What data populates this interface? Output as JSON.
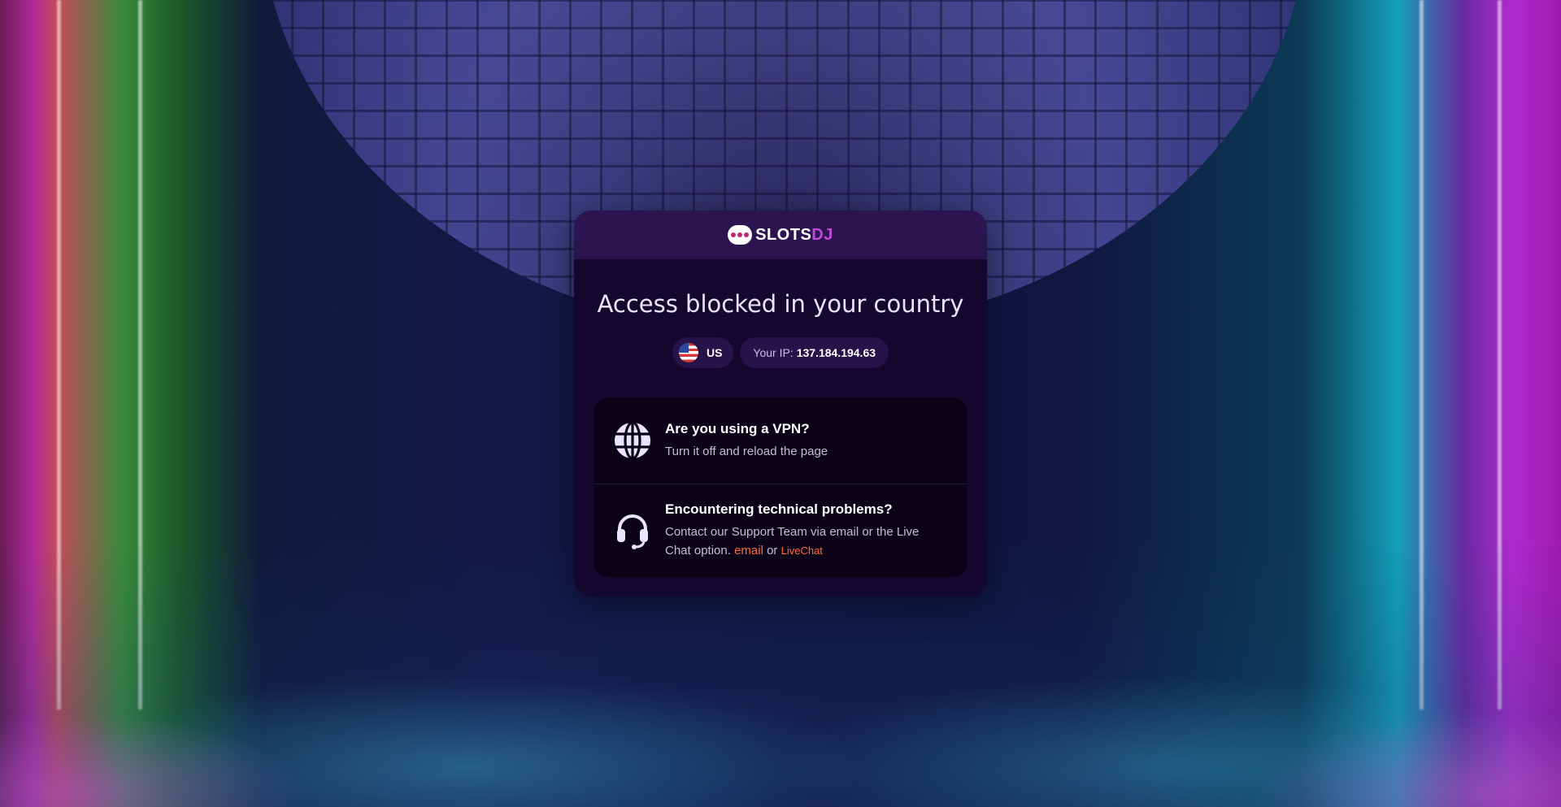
{
  "brand": {
    "logo_text_main": "SLOTS",
    "logo_text_accent": "DJ",
    "accent_color": "#c04ad8"
  },
  "page": {
    "title": "Access blocked in your country"
  },
  "location": {
    "country_code": "US",
    "flag_icon": "us-flag-icon",
    "ip_label": "Your IP:",
    "ip_value": "137.184.194.63"
  },
  "tips": [
    {
      "icon": "globe-icon",
      "title": "Are you using a VPN?",
      "text": "Turn it off and reload the page"
    },
    {
      "icon": "headset-icon",
      "title": "Encountering technical problems?",
      "text": "Contact our Support Team via email or the Live Chat option.",
      "link_email": "email",
      "connector": "or",
      "link_livechat": "LiveChat"
    }
  ],
  "colors": {
    "card_bg": "#14082f",
    "header_bg": "#2b1450",
    "link": "#ff6a3a"
  }
}
